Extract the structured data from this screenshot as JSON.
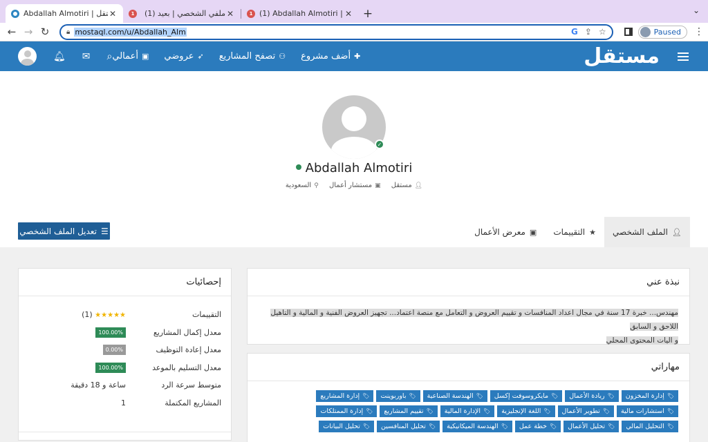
{
  "browser": {
    "tabs": [
      {
        "title": "Abdallah Almotiri | مستقل",
        "active": true,
        "favicon": "mostaql-circle-icon"
      },
      {
        "title": "(1) ملفي الشخصي | بعيد",
        "active": false,
        "favicon": "baeed-icon"
      },
      {
        "title": "(1) Abdallah Almotiri | بعيد",
        "active": false,
        "favicon": "baeed-icon"
      }
    ],
    "new_tab": "+",
    "url": "mostaql.com/u/Abdallah_Alm",
    "profile_status": "Paused"
  },
  "header": {
    "logo": "مستقل",
    "nav": [
      {
        "label": "أضف مشروع",
        "icon": "plus-icon"
      },
      {
        "label": "تصفح المشاريع",
        "icon": "users-icon"
      },
      {
        "label": "عروضي",
        "icon": "send-icon"
      },
      {
        "label": "أعمالي",
        "icon": "briefcase-icon"
      }
    ],
    "accent": "#2b7bbd"
  },
  "profile": {
    "name": "Abdallah Almotiri",
    "meta": {
      "role": "مستقل",
      "title": "مستشار أعمال",
      "country": "السعودية"
    },
    "edit_button": "تعديل الملف الشخصي",
    "tabs": [
      {
        "label": "الملف الشخصي",
        "icon": "user-icon",
        "active": true
      },
      {
        "label": "التقييمات",
        "icon": "star-icon",
        "active": false
      },
      {
        "label": "معرض الأعمال",
        "icon": "briefcase-icon",
        "active": false
      }
    ]
  },
  "stats": {
    "title": "إحصائيات",
    "rows": [
      {
        "label": "التقييمات",
        "value": "(1)",
        "stars": "★★★★★"
      },
      {
        "label": "معدل إكمال المشاريع",
        "value": "100.00%",
        "badge": "green"
      },
      {
        "label": "معدل إعادة التوظيف",
        "value": "0.00%",
        "badge": "gray"
      },
      {
        "label": "معدل التسليم بالموعد",
        "value": "100.00%",
        "badge": "green"
      },
      {
        "label": "متوسط سرعة الرد",
        "value": "ساعة و 18 دقيقة"
      },
      {
        "label": "المشاريع المكتملة",
        "value": "1"
      }
    ]
  },
  "about": {
    "title": "نبذة عني",
    "text_line1": "مهندس... خبرة 17 سنة في مجال اعداد المنافسات و تقييم العروض و التعامل مع منصة اعتماد... تجهيز العروض الفنية و المالية و التاهيل اللاحق و السابق",
    "text_line2": "و اليات المحتوى المحلي"
  },
  "skills": {
    "title": "مهاراتي",
    "items": [
      "إدارة المخزون",
      "ريادة الأعمال",
      "مايكروسوفت إكسل",
      "الهندسة الصناعية",
      "باوربوينت",
      "إدارة المشاريع",
      "استشارات مالية",
      "تطوير الأعمال",
      "اللغة الإنجليزية",
      "الإدارة المالية",
      "تقييم المشاريع",
      "إدارة الممتلكات",
      "التحليل المالي",
      "تحليل الأعمال",
      "خطة عمل",
      "الهندسة الميكانيكية",
      "تحليل المنافسين",
      "تحليل البيانات"
    ]
  }
}
